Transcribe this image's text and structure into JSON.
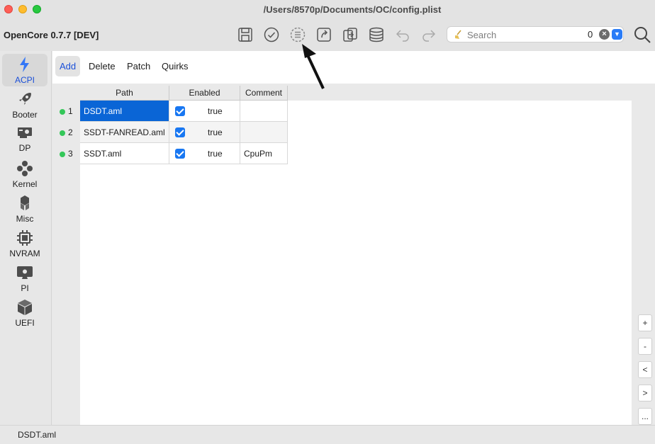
{
  "window": {
    "title": "/Users/8570p/Documents/OC/config.plist"
  },
  "toolbar": {
    "app_label": "OpenCore 0.7.7 [DEV]",
    "icons": [
      "save-icon",
      "check-icon",
      "list-icon",
      "share-icon",
      "transfer-icon",
      "database-icon",
      "undo-icon",
      "redo-icon"
    ],
    "search": {
      "placeholder": "Search",
      "count": "0"
    }
  },
  "sidebar": {
    "items": [
      {
        "label": "ACPI",
        "icon": "acpi-icon",
        "active": true
      },
      {
        "label": "Booter",
        "icon": "rocket-icon"
      },
      {
        "label": "DP",
        "icon": "graphics-card-icon"
      },
      {
        "label": "Kernel",
        "icon": "kernel-icon"
      },
      {
        "label": "Misc",
        "icon": "misc-icon"
      },
      {
        "label": "NVRAM",
        "icon": "chip-icon"
      },
      {
        "label": "PI",
        "icon": "monitor-apple-icon"
      },
      {
        "label": "UEFI",
        "icon": "box-icon"
      }
    ]
  },
  "subtabs": [
    {
      "label": "Add",
      "active": true
    },
    {
      "label": "Delete"
    },
    {
      "label": "Patch"
    },
    {
      "label": "Quirks"
    }
  ],
  "table": {
    "columns": [
      "Path",
      "Enabled",
      "Comment"
    ],
    "rows": [
      {
        "num": "1",
        "path": "DSDT.aml",
        "enabled": "true",
        "comment": ""
      },
      {
        "num": "2",
        "path": "SSDT-FANREAD.aml",
        "enabled": "true",
        "comment": ""
      },
      {
        "num": "3",
        "path": "SSDT.aml",
        "enabled": "true",
        "comment": "CpuPm"
      }
    ]
  },
  "side_buttons": [
    "+",
    "-",
    "<",
    ">",
    "..."
  ],
  "status": {
    "text": "DSDT.aml"
  },
  "colors": {
    "accent": "#1a4fd8",
    "selection": "#0a65d6",
    "status_dot": "#34c759"
  }
}
